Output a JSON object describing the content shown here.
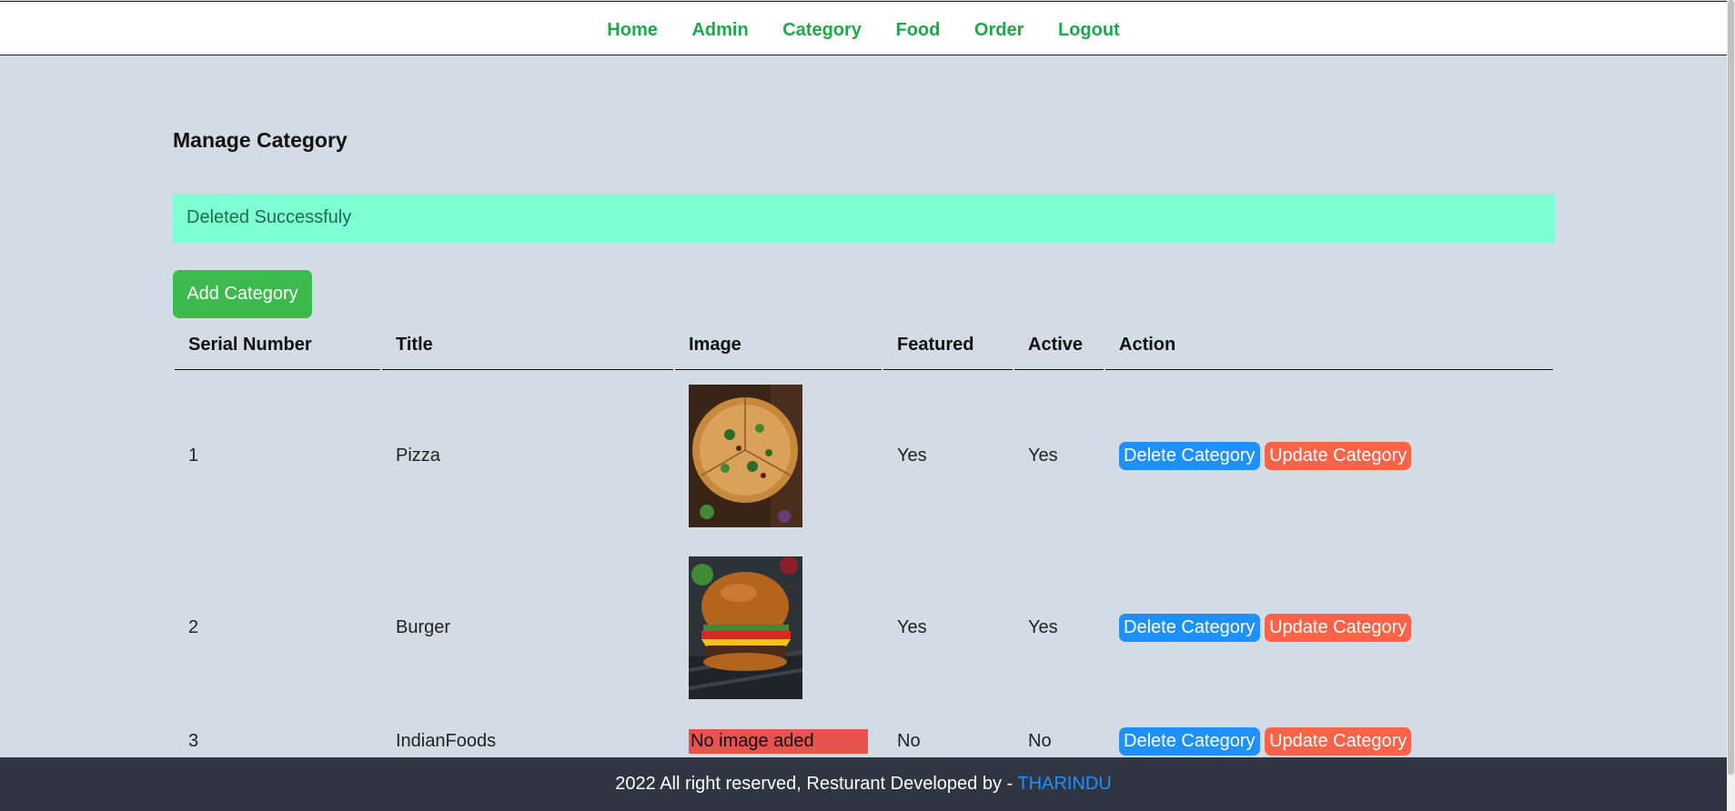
{
  "nav": {
    "items": [
      "Home",
      "Admin",
      "Category",
      "Food",
      "Order",
      "Logout"
    ]
  },
  "page": {
    "title": "Manage Category",
    "alert": "Deleted Successfuly",
    "add_button": "Add Category"
  },
  "table": {
    "headers": [
      "Serial Number",
      "Title",
      "Image",
      "Featured",
      "Active",
      "Action"
    ],
    "rows": [
      {
        "serial": "1",
        "title": "Pizza",
        "image": "pizza-image",
        "featured": "Yes",
        "active": "Yes"
      },
      {
        "serial": "2",
        "title": "Burger",
        "image": "burger-image",
        "featured": "Yes",
        "active": "Yes"
      },
      {
        "serial": "3",
        "title": "IndianFoods",
        "image_text": "No image aded",
        "featured": "No",
        "active": "No"
      }
    ],
    "delete_label": "Delete Category",
    "update_label": "Update Category"
  },
  "footer": {
    "text": "2022 All right reserved, Resturant Developed by - ",
    "author": "THARINDU"
  },
  "colors": {
    "nav_link": "#1ea84a",
    "alert_bg": "#7fffd4",
    "add_button": "#3dba4e",
    "delete_button": "#1e90ff",
    "update_button": "#ff6347",
    "no_image_bg": "#e8534f",
    "footer_bg": "#2f3542"
  }
}
